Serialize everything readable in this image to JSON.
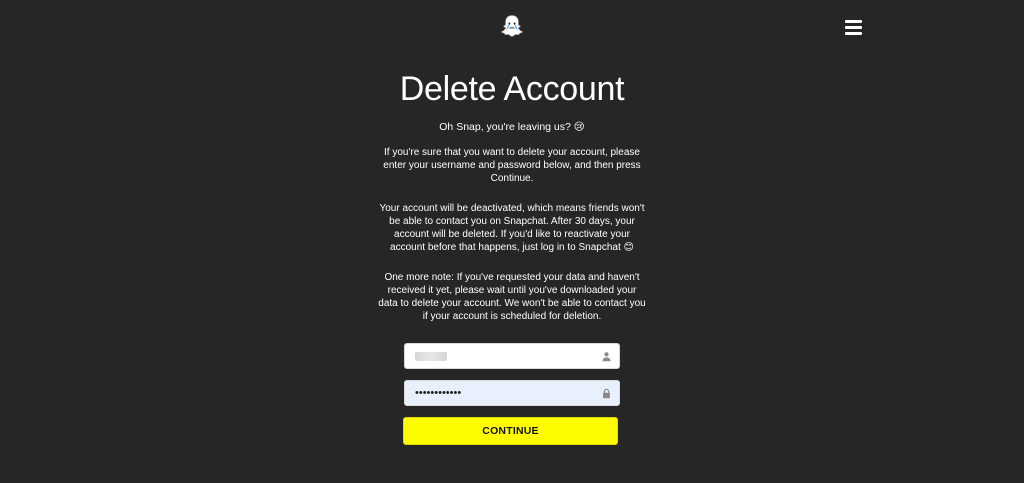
{
  "header": {
    "logo_icon": "snapchat-ghost-icon",
    "menu_icon": "hamburger-menu-icon"
  },
  "main": {
    "title": "Delete Account",
    "subtitle": "Oh Snap, you're leaving us? 😢",
    "paragraph1": "If you're sure that you want to delete your account, please enter your username and password below, and then press Continue.",
    "paragraph2": "Your account will be deactivated, which means friends won't be able to contact you on Snapchat. After 30 days, your account will be deleted. If you'd like to reactivate your account before that happens, just log in to Snapchat 😊",
    "paragraph3": "One more note: If you've requested your data and haven't received it yet, please wait until you've downloaded your data to delete your account. We won't be able to contact you if your account is scheduled for deletion."
  },
  "form": {
    "username": {
      "value": "",
      "icon": "user-icon"
    },
    "password": {
      "value": "••••••••••••",
      "icon": "lock-icon"
    },
    "continue_label": "CONTINUE"
  },
  "colors": {
    "background": "#262626",
    "text": "#ffffff",
    "button": "#fffc00",
    "password_bg": "#e8f0fe"
  }
}
